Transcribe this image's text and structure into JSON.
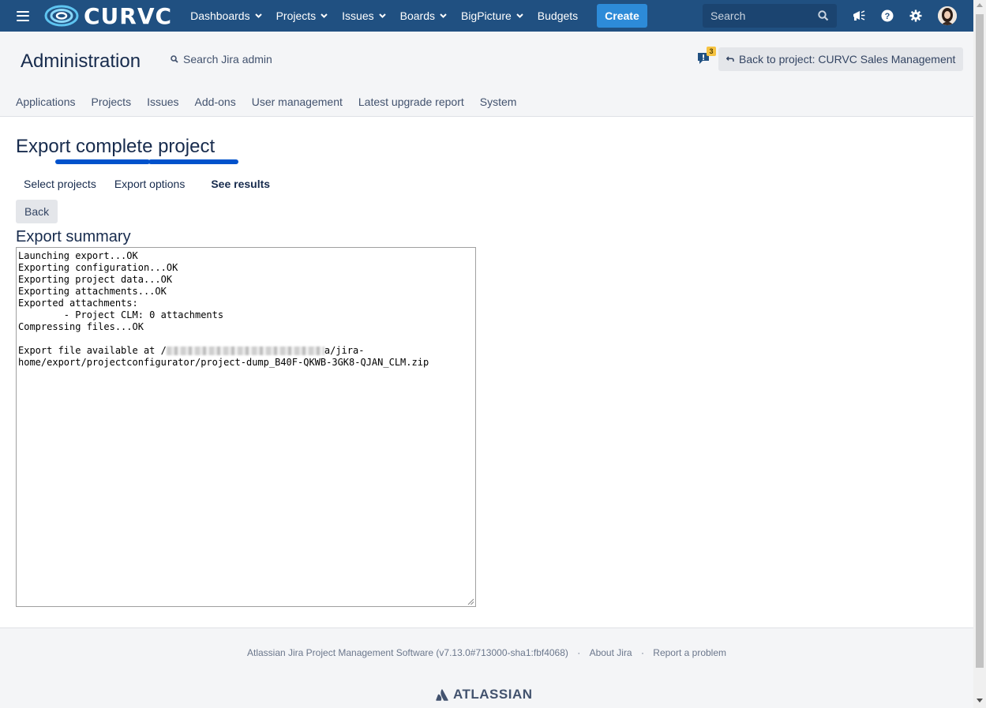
{
  "topnav": {
    "logo_text": "CURVC",
    "menu": [
      {
        "label": "Dashboards",
        "dropdown": true
      },
      {
        "label": "Projects",
        "dropdown": true
      },
      {
        "label": "Issues",
        "dropdown": true
      },
      {
        "label": "Boards",
        "dropdown": true
      },
      {
        "label": "BigPicture",
        "dropdown": true
      },
      {
        "label": "Budgets",
        "dropdown": false
      }
    ],
    "create_label": "Create",
    "search_placeholder": "Search",
    "icons": [
      "megaphone-icon",
      "help-icon",
      "gear-icon"
    ],
    "bg_color": "#205081"
  },
  "admin": {
    "title": "Administration",
    "search_label": "Search Jira admin",
    "notification_count": "3",
    "back_to_project": "Back to project: CURVC Sales Management",
    "tabs": [
      "Applications",
      "Projects",
      "Issues",
      "Add-ons",
      "User management",
      "Latest upgrade report",
      "System"
    ]
  },
  "main": {
    "page_title": "Export complete project",
    "steps": [
      {
        "label": "Select projects",
        "current": false
      },
      {
        "label": "Export options",
        "current": false
      },
      {
        "label": "See results",
        "current": true
      }
    ],
    "progress_steps_complete": 3,
    "back_label": "Back",
    "summary_title": "Export summary",
    "summary_lines": [
      "Launching export...OK",
      "Exporting configuration...OK",
      "Exporting project data...OK",
      "Exporting attachments...OK",
      "Exported attachments:",
      "        - Project CLM: 0 attachments",
      "Compressing files...OK",
      ""
    ],
    "export_path_prefix": "Export file available at /",
    "export_path_suffix": "a/jira-",
    "export_path_line2": "home/export/projectconfigurator/project-dump_B40F-QKWB-3GK8-QJAN_CLM.zip"
  },
  "footer": {
    "software": "Atlassian Jira Project Management Software (v7.13.0#713000-sha1:fbf4068)",
    "about": "About Jira",
    "report": "Report a problem",
    "brand": "ATLASSIAN"
  },
  "colors": {
    "accent": "#0052cc",
    "header_bg": "#f4f5f7",
    "badge": "#f6c342"
  }
}
